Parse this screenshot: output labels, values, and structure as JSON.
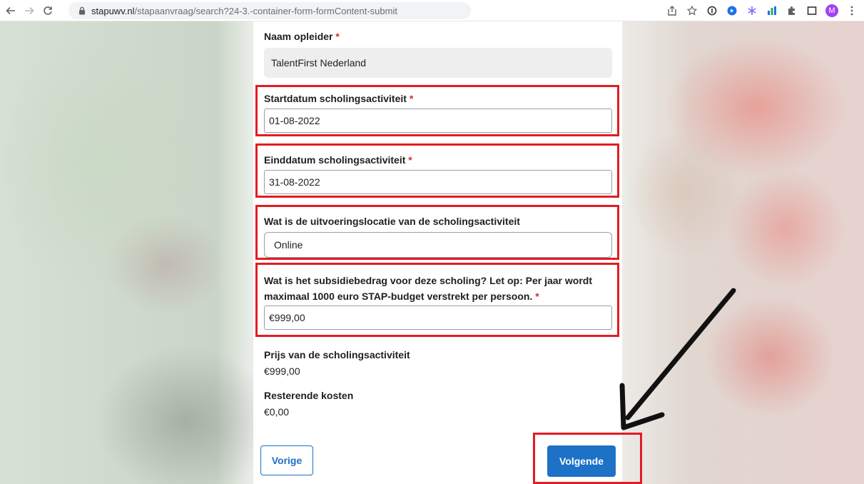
{
  "browser": {
    "url_host": "stapuwv.nl",
    "url_path": "/stapaanvraag/search?24-3.-container-form-formContent-submit",
    "profile_initial": "M",
    "extension_colors": [
      "#1a73e8",
      "#7b61ff",
      "#34a853"
    ]
  },
  "form": {
    "training_provider": {
      "label": "Naam opleider",
      "required_marker": "*",
      "value": "TalentFirst Nederland"
    },
    "start_date": {
      "label": "Startdatum scholingsactiviteit",
      "required_marker": "*",
      "value": "01-08-2022"
    },
    "end_date": {
      "label": "Einddatum scholingsactiviteit",
      "required_marker": "*",
      "value": "31-08-2022"
    },
    "location": {
      "label": "Wat is de uitvoeringslocatie van de scholingsactiviteit",
      "value": "Online"
    },
    "subsidy": {
      "label_line1": "Wat is het subsidiebedrag voor deze scholing? Let op: Per jaar wordt",
      "label_line2": "maximaal 1000 euro STAP-budget verstrekt per persoon.",
      "required_marker": "*",
      "value": "€999,00"
    },
    "price": {
      "label": "Prijs van de scholingsactiviteit",
      "value": "€999,00"
    },
    "remaining": {
      "label": "Resterende kosten",
      "value": "€0,00"
    },
    "buttons": {
      "previous": "Vorige",
      "next": "Volgende"
    }
  },
  "annotation": {
    "highlight_color": "#e21c23",
    "arrow_color": "#111111"
  }
}
